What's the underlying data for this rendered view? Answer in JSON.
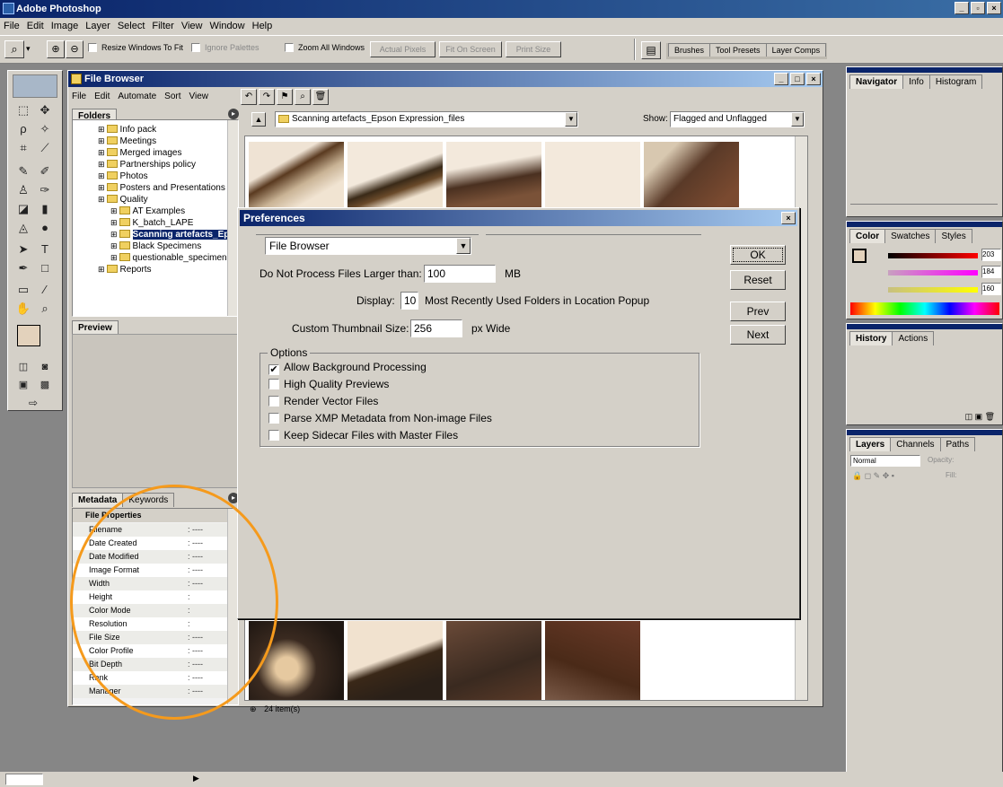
{
  "app": {
    "title": "Adobe Photoshop"
  },
  "menu": [
    "File",
    "Edit",
    "Image",
    "Layer",
    "Select",
    "Filter",
    "View",
    "Window",
    "Help"
  ],
  "options_bar": {
    "resize_windows": "Resize Windows To Fit",
    "ignore_palettes": "Ignore Palettes",
    "zoom_all": "Zoom All Windows",
    "actual_pixels": "Actual Pixels",
    "fit_on_screen": "Fit On Screen",
    "print_size": "Print Size",
    "palette_tabs": [
      "Brushes",
      "Tool Presets",
      "Layer Comps"
    ]
  },
  "file_browser": {
    "title": "File Browser",
    "menu": [
      "File",
      "Edit",
      "Automate",
      "Sort",
      "View"
    ],
    "folders_tab": "Folders",
    "folders": [
      {
        "label": "Info pack",
        "indent": 2
      },
      {
        "label": "Meetings",
        "indent": 2
      },
      {
        "label": "Merged images",
        "indent": 2
      },
      {
        "label": "Partnerships policy",
        "indent": 2
      },
      {
        "label": "Photos",
        "indent": 2
      },
      {
        "label": "Posters and Presentations",
        "indent": 2
      },
      {
        "label": "Quality",
        "indent": 2
      },
      {
        "label": "AT Examples",
        "indent": 3
      },
      {
        "label": "K_batch_LAPE",
        "indent": 3
      },
      {
        "label": "Scanning artefacts_Ep",
        "indent": 3,
        "selected": true
      },
      {
        "label": "Black Specimens",
        "indent": 3
      },
      {
        "label": "questionable_specimens",
        "indent": 3
      },
      {
        "label": "Reports",
        "indent": 2
      }
    ],
    "preview_tab": "Preview",
    "location": "Scanning artefacts_Epson Expression_files",
    "show_label": "Show:",
    "show_value": "Flagged and Unflagged",
    "status": "24 item(s)",
    "metadata_tabs": [
      "Metadata",
      "Keywords"
    ],
    "file_properties_label": "File Properties",
    "file_properties": [
      {
        "key": "Filename",
        "value": ": ----"
      },
      {
        "key": "Date Created",
        "value": ": ----"
      },
      {
        "key": "Date Modified",
        "value": ": ----"
      },
      {
        "key": "Image Format",
        "value": ": ----"
      },
      {
        "key": "Width",
        "value": ": ----"
      },
      {
        "key": "Height",
        "value": ":"
      },
      {
        "key": "Color Mode",
        "value": ":"
      },
      {
        "key": "Resolution",
        "value": ":"
      },
      {
        "key": "File Size",
        "value": ": ----"
      },
      {
        "key": "Color Profile",
        "value": ": ----"
      },
      {
        "key": "Bit Depth",
        "value": ": ----"
      },
      {
        "key": "Rank",
        "value": ": ----"
      },
      {
        "key": "Manager",
        "value": ": ----"
      }
    ]
  },
  "preferences": {
    "title": "Preferences",
    "section": "File Browser",
    "max_size_label": "Do Not Process Files Larger than:",
    "max_size_value": "100",
    "max_size_unit": "MB",
    "display_label": "Display:",
    "display_value": "10",
    "display_suffix": "Most Recently Used Folders in Location Popup",
    "thumb_label": "Custom Thumbnail Size:",
    "thumb_value": "256",
    "thumb_unit": "px Wide",
    "options_label": "Options",
    "options": [
      {
        "label": "Allow Background Processing",
        "checked": true
      },
      {
        "label": "High Quality Previews",
        "checked": false
      },
      {
        "label": "Render Vector Files",
        "checked": false
      },
      {
        "label": "Parse XMP Metadata from Non-image Files",
        "checked": false
      },
      {
        "label": "Keep Sidecar Files with Master Files",
        "checked": false
      }
    ],
    "buttons": {
      "ok": "OK",
      "reset": "Reset",
      "prev": "Prev",
      "next": "Next"
    }
  },
  "palettes": {
    "navigator_tabs": [
      "Navigator",
      "Info",
      "Histogram"
    ],
    "color_tabs": [
      "Color",
      "Swatches",
      "Styles"
    ],
    "color_values": {
      "r": "203",
      "g": "184",
      "b": "160"
    },
    "history_tabs": [
      "History",
      "Actions"
    ],
    "layers_tabs": [
      "Layers",
      "Channels",
      "Paths"
    ],
    "blend_mode": "Normal",
    "opacity_label": "Opacity:",
    "fill_label": "Fill:"
  },
  "colors": {
    "highlight_ring": "#f59a1c",
    "title_blue": "#0a246a",
    "face": "#d4d0c8"
  }
}
